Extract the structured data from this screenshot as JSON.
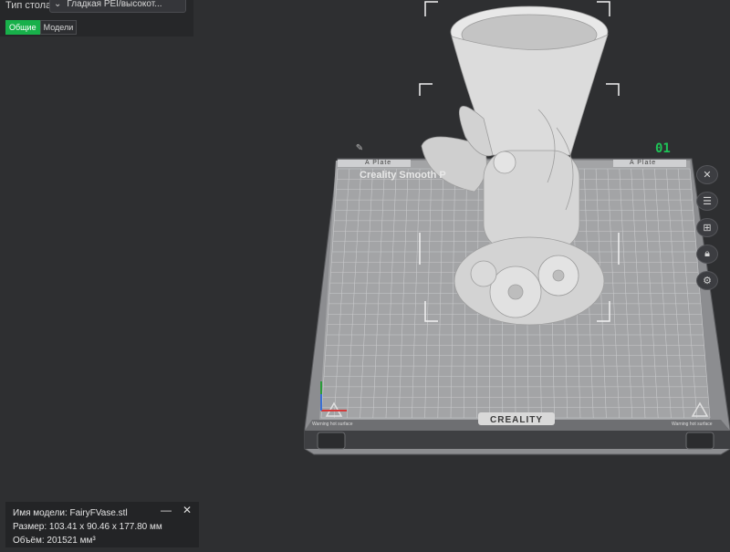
{
  "settings": {
    "plate_type_label": "Тип стола",
    "plate_type_value": "Гладкая PEI/высокот...",
    "tabs": [
      {
        "label": "Общие",
        "active": true
      },
      {
        "label": "Модели",
        "active": false
      }
    ]
  },
  "bed": {
    "plate_number": "01",
    "plate_name": "Creality Smooth P",
    "corner_label": "A Plate",
    "warning_label": "Warning hot surface",
    "brand": "CREALITY"
  },
  "tools": [
    "close-icon",
    "list-icon",
    "auto-arrange-icon",
    "lock-icon",
    "gear-icon"
  ],
  "model_info": {
    "name": "Имя модели: FairyFVase.stl",
    "size": "Размер: 103.41 x 90.46 x 177.80 мм",
    "volume": "Объём: 201521 мм³",
    "minimize": "—",
    "close": "✕"
  },
  "colors": {
    "background": "#2e2f31",
    "accent": "#18b04a",
    "plate_number": "#1fc257",
    "bed": "#9a9b9d"
  }
}
